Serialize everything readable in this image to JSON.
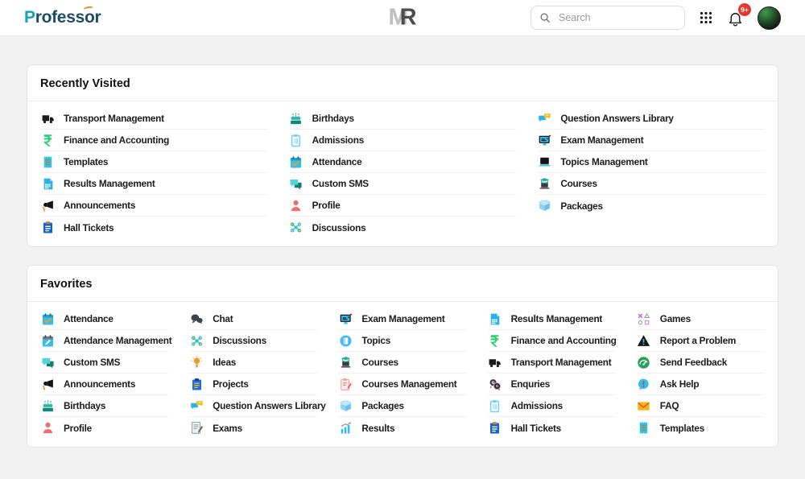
{
  "header": {
    "brand": {
      "p": "P",
      "mid": "rofess",
      "o": "o",
      "suffix": "r"
    },
    "logo_mark": {
      "m": "M",
      "r": "R"
    },
    "search": {
      "placeholder": "Search"
    },
    "badge": "9+"
  },
  "colors": {
    "brand_teal": "#12a3b4",
    "brand_navy": "#1d4d66",
    "accent_orange": "#f58220",
    "badge_red": "#e8392e",
    "icon_cyan": "#35bdee",
    "icon_teal": "#27b5a7",
    "icon_green": "#2fce71"
  },
  "sections": [
    {
      "title": "Recently Visited",
      "columns": [
        {
          "items": [
            {
              "label": "Transport Management",
              "icon": "truck-icon"
            },
            {
              "label": "Finance and Accounting",
              "icon": "rupee-icon"
            },
            {
              "label": "Templates",
              "icon": "receipt-icon"
            },
            {
              "label": "Results Management",
              "icon": "document-grid-icon"
            },
            {
              "label": "Announcements",
              "icon": "megaphone-icon"
            },
            {
              "label": "Hall Tickets",
              "icon": "clipboard-blue-icon"
            }
          ]
        },
        {
          "items": [
            {
              "label": "Birthdays",
              "icon": "cake-icon"
            },
            {
              "label": "Admissions",
              "icon": "clipboard-light-icon"
            },
            {
              "label": "Attendance",
              "icon": "calendar-check-icon"
            },
            {
              "label": "Custom SMS",
              "icon": "sms-bubbles-icon"
            },
            {
              "label": "Profile",
              "icon": "person-icon"
            },
            {
              "label": "Discussions",
              "icon": "network-icon"
            }
          ]
        },
        {
          "items": [
            {
              "label": "Question Answers Library",
              "icon": "qa-chat-icon"
            },
            {
              "label": "Exam Management",
              "icon": "exam-monitor-icon"
            },
            {
              "label": "Topics Management",
              "icon": "laptop-icon"
            },
            {
              "label": "Courses",
              "icon": "course-laptop-icon"
            },
            {
              "label": "Packages",
              "icon": "package-box-icon"
            }
          ]
        }
      ]
    },
    {
      "title": "Favorites",
      "columns": [
        {
          "items": [
            {
              "label": "Attendance",
              "icon": "calendar-check-icon"
            },
            {
              "label": "Attendance Management",
              "icon": "calendar-pencil-icon"
            },
            {
              "label": "Custom SMS",
              "icon": "sms-bubbles-icon"
            },
            {
              "label": "Announcements",
              "icon": "megaphone-icon"
            },
            {
              "label": "Birthdays",
              "icon": "cake-icon"
            },
            {
              "label": "Profile",
              "icon": "person-icon"
            }
          ]
        },
        {
          "items": [
            {
              "label": "Chat",
              "icon": "chat-dark-icon"
            },
            {
              "label": "Discussions",
              "icon": "network-icon"
            },
            {
              "label": "Ideas",
              "icon": "bulb-icon"
            },
            {
              "label": "Projects",
              "icon": "clipboard-projects-icon"
            },
            {
              "label": "Question Answers Library",
              "icon": "qa-chat-icon"
            },
            {
              "label": "Exams",
              "icon": "exam-paper-icon"
            }
          ]
        },
        {
          "items": [
            {
              "label": "Exam Management",
              "icon": "exam-monitor-icon"
            },
            {
              "label": "Topics",
              "icon": "topic-circle-icon"
            },
            {
              "label": "Courses",
              "icon": "course-laptop-icon"
            },
            {
              "label": "Courses Management",
              "icon": "clipboard-pink-icon"
            },
            {
              "label": "Packages",
              "icon": "package-box-icon"
            },
            {
              "label": "Results",
              "icon": "bar-chart-icon"
            }
          ]
        },
        {
          "items": [
            {
              "label": "Results Management",
              "icon": "document-grid-icon"
            },
            {
              "label": "Finance and Accounting",
              "icon": "rupee-icon"
            },
            {
              "label": "Transport Management",
              "icon": "truck-icon"
            },
            {
              "label": "Enquries",
              "icon": "enquiry-circles-icon"
            },
            {
              "label": "Admissions",
              "icon": "clipboard-light-icon"
            },
            {
              "label": "Hall Tickets",
              "icon": "clipboard-blue-icon"
            }
          ]
        },
        {
          "items": [
            {
              "label": "Games",
              "icon": "game-shapes-icon"
            },
            {
              "label": "Report a Problem",
              "icon": "warning-triangle-icon"
            },
            {
              "label": "Send Feedback",
              "icon": "gauge-icon"
            },
            {
              "label": "Ask Help",
              "icon": "help-bubble-icon"
            },
            {
              "label": "FAQ",
              "icon": "envelope-icon"
            },
            {
              "label": "Templates",
              "icon": "receipt-icon"
            }
          ]
        }
      ]
    }
  ]
}
